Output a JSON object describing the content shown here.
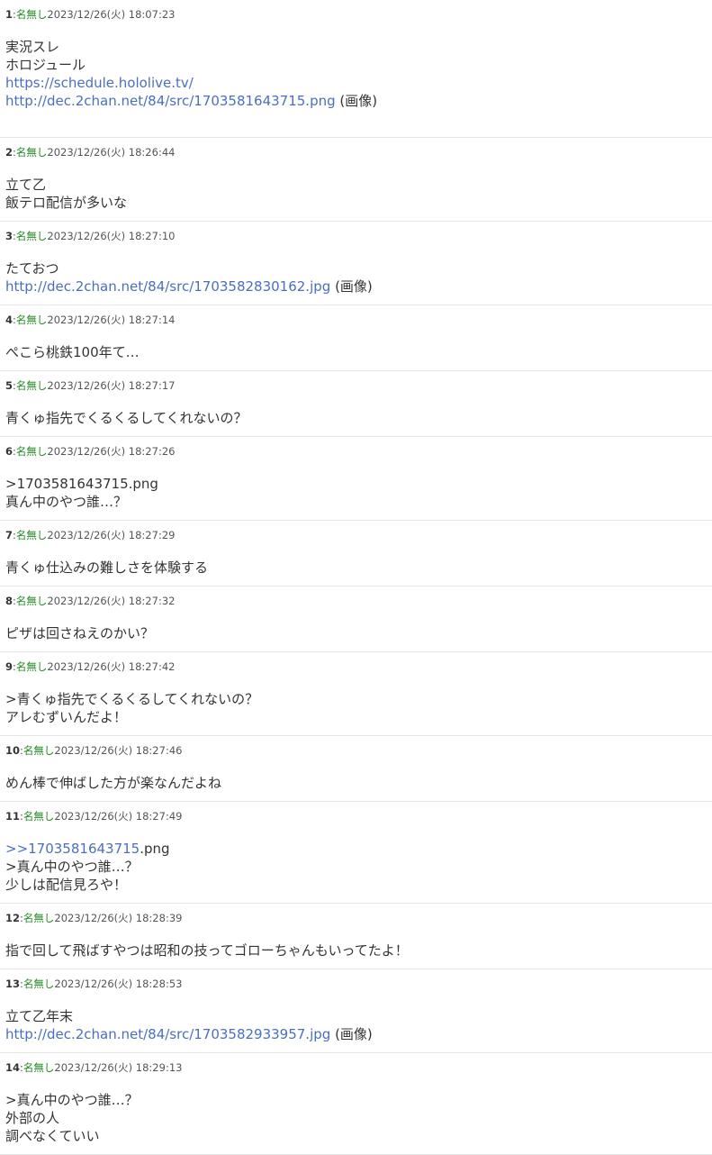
{
  "posts": [
    {
      "no": "1",
      "name": "名無し",
      "date": "2023/12/26(火) 18:07:23",
      "lines": [
        {
          "type": "text",
          "text": "実況スレ"
        },
        {
          "type": "text",
          "text": "ホロジュール"
        },
        {
          "type": "link",
          "text": "https://schedule.hololive.tv/"
        },
        {
          "type": "image",
          "text": "http://dec.2chan.net/84/src/1703581643715.png",
          "suffix": " (画像)"
        }
      ]
    },
    {
      "no": "2",
      "name": "名無し",
      "date": "2023/12/26(火) 18:26:44",
      "lines": [
        {
          "type": "text",
          "text": "立て乙"
        },
        {
          "type": "text",
          "text": "飯テロ配信が多いな"
        }
      ]
    },
    {
      "no": "3",
      "name": "名無し",
      "date": "2023/12/26(火) 18:27:10",
      "lines": [
        {
          "type": "text",
          "text": "たておつ"
        },
        {
          "type": "image",
          "text": "http://dec.2chan.net/84/src/1703582830162.jpg",
          "suffix": " (画像)"
        }
      ]
    },
    {
      "no": "4",
      "name": "名無し",
      "date": "2023/12/26(火) 18:27:14",
      "lines": [
        {
          "type": "text",
          "text": "ぺこら桃鉄100年て…"
        }
      ]
    },
    {
      "no": "5",
      "name": "名無し",
      "date": "2023/12/26(火) 18:27:17",
      "lines": [
        {
          "type": "text",
          "text": "青くゅ指先でくるくるしてくれないの？"
        }
      ]
    },
    {
      "no": "6",
      "name": "名無し",
      "date": "2023/12/26(火) 18:27:26",
      "lines": [
        {
          "type": "text",
          "text": ">1703581643715.png"
        },
        {
          "type": "text",
          "text": "真ん中のやつ誰…？"
        }
      ]
    },
    {
      "no": "7",
      "name": "名無し",
      "date": "2023/12/26(火) 18:27:29",
      "lines": [
        {
          "type": "text",
          "text": "青くゅ仕込みの難しさを体験する"
        }
      ]
    },
    {
      "no": "8",
      "name": "名無し",
      "date": "2023/12/26(火) 18:27:32",
      "lines": [
        {
          "type": "text",
          "text": "ピザは回さねえのかい？"
        }
      ]
    },
    {
      "no": "9",
      "name": "名無し",
      "date": "2023/12/26(火) 18:27:42",
      "lines": [
        {
          "type": "text",
          "text": ">青くゅ指先でくるくるしてくれないの？"
        },
        {
          "type": "text",
          "text": "アレむずいんだよ！"
        }
      ]
    },
    {
      "no": "10",
      "name": "名無し",
      "date": "2023/12/26(火) 18:27:46",
      "lines": [
        {
          "type": "text",
          "text": "めん棒で伸ばした方が楽なんだよね"
        }
      ]
    },
    {
      "no": "11",
      "name": "名無し",
      "date": "2023/12/26(火) 18:27:49",
      "lines": [
        {
          "type": "reply",
          "text": ">>1703581643715",
          "suffix": ".png"
        },
        {
          "type": "text",
          "text": ">真ん中のやつ誰…？"
        },
        {
          "type": "text",
          "text": "少しは配信見ろや！"
        }
      ]
    },
    {
      "no": "12",
      "name": "名無し",
      "date": "2023/12/26(火) 18:28:39",
      "lines": [
        {
          "type": "text",
          "text": "指で回して飛ばすやつは昭和の技ってゴローちゃんもいってたよ！"
        }
      ]
    },
    {
      "no": "13",
      "name": "名無し",
      "date": "2023/12/26(火) 18:28:53",
      "lines": [
        {
          "type": "text",
          "text": "立て乙年末"
        },
        {
          "type": "image",
          "text": "http://dec.2chan.net/84/src/1703582933957.jpg",
          "suffix": " (画像)"
        }
      ]
    },
    {
      "no": "14",
      "name": "名無し",
      "date": "2023/12/26(火) 18:29:13",
      "lines": [
        {
          "type": "text",
          "text": ">真ん中のやつ誰…？"
        },
        {
          "type": "text",
          "text": "外部の人"
        },
        {
          "type": "text",
          "text": "調べなくていい"
        }
      ]
    }
  ]
}
